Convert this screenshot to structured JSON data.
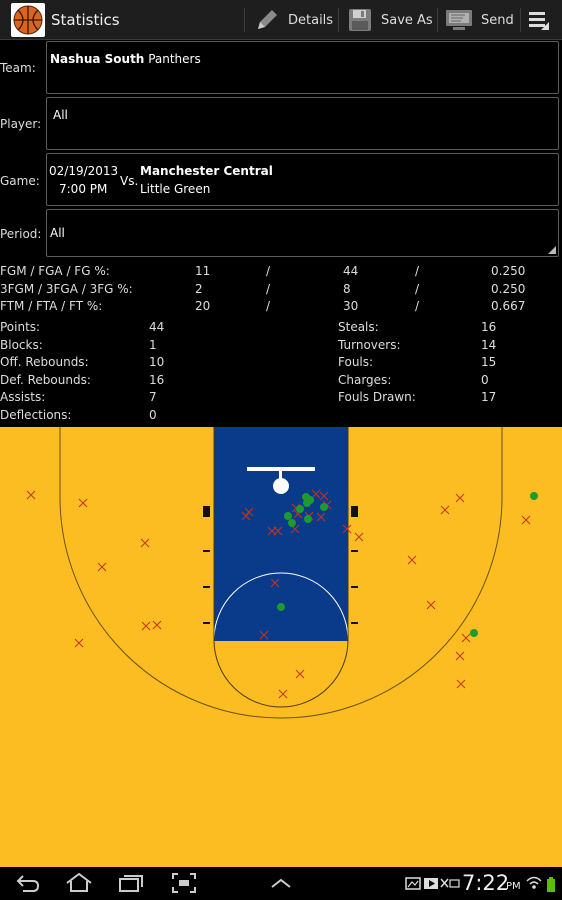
{
  "app": {
    "title": "Statistics",
    "icon": "basketball-icon"
  },
  "actions": [
    {
      "label": "Details",
      "icon": "pencil-icon"
    },
    {
      "label": "Save As",
      "icon": "save-icon"
    },
    {
      "label": "Send",
      "icon": "send-icon"
    }
  ],
  "form": {
    "team": {
      "label": "Team:",
      "bold": "Nashua South",
      "rest": "Panthers"
    },
    "player": {
      "label": "Player:",
      "value": "All"
    },
    "game": {
      "label": "Game:",
      "date": "02/19/2013",
      "time": "7:00 PM",
      "vs": "Vs.",
      "opponent_line1": "Manchester Central",
      "opponent_line2": "Little Green"
    },
    "period": {
      "label": "Period:",
      "value": "All"
    }
  },
  "shooting": [
    {
      "label": "FGM / FGA / FG %:",
      "made": "11",
      "attempted": "44",
      "pct": "0.250"
    },
    {
      "label": "3FGM / 3FGA / 3FG %:",
      "made": "2",
      "attempted": "8",
      "pct": "0.250"
    },
    {
      "label": "FTM / FTA / FT %:",
      "made": "20",
      "attempted": "30",
      "pct": "0.667"
    }
  ],
  "separator": "/",
  "stats_left": [
    {
      "label": "Points:",
      "value": "44"
    },
    {
      "label": "Blocks:",
      "value": "1"
    },
    {
      "label": "Off. Rebounds:",
      "value": "10"
    },
    {
      "label": "Def. Rebounds:",
      "value": "16"
    },
    {
      "label": "Assists:",
      "value": "7"
    },
    {
      "label": "Deflections:",
      "value": "0"
    }
  ],
  "stats_right": [
    {
      "label": "Steals:",
      "value": "16"
    },
    {
      "label": "Turnovers:",
      "value": "14"
    },
    {
      "label": "Fouls:",
      "value": "15"
    },
    {
      "label": "Charges:",
      "value": "0"
    },
    {
      "label": "Fouls Drawn:",
      "value": "17"
    }
  ],
  "court": {
    "floor_color": "#fbbd22",
    "paint_color": "#0a3a8a",
    "made_color": "#1f9a2f",
    "missed_color": "#c2351a",
    "shots_made": 11,
    "shots_missed": 33
  },
  "status": {
    "time": "7:22",
    "ampm": "PM"
  }
}
